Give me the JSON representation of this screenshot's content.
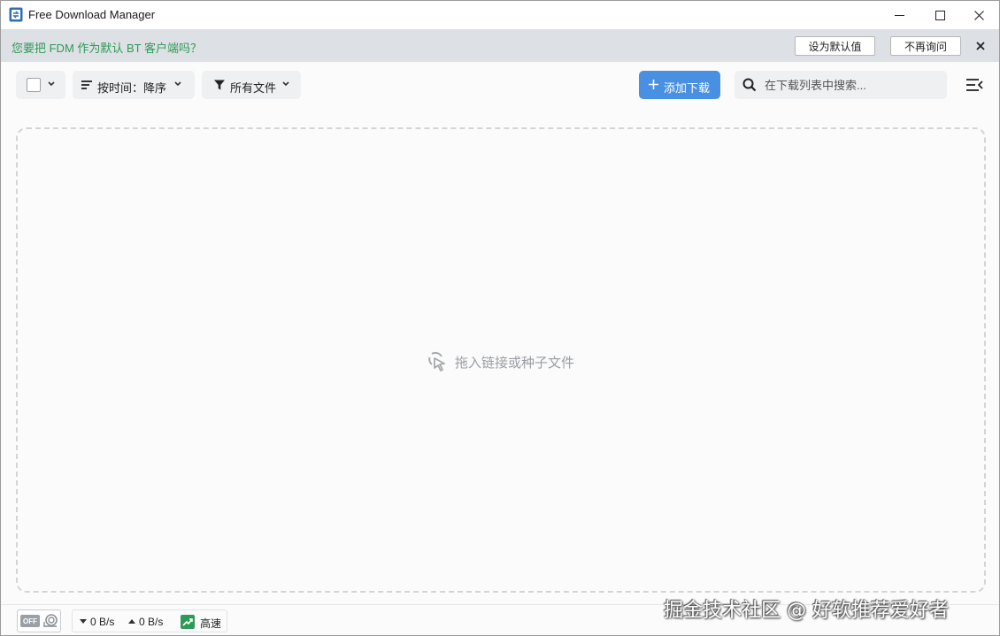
{
  "window": {
    "title": "Free Download Manager"
  },
  "bt_prompt": {
    "message": "您要把 FDM 作为默认 BT 客户端吗？",
    "set_default_label": "设为默认值",
    "never_ask_label": "不再询问"
  },
  "toolbar": {
    "sort_label": "按时间：降序",
    "filter_label": "所有文件",
    "add_download_label": "添加下载",
    "search_placeholder": "在下载列表中搜索..."
  },
  "dropzone": {
    "hint": "拖入链接或种子文件"
  },
  "statusbar": {
    "snail_mode": "OFF",
    "download_speed": "0 B/s",
    "upload_speed": "0 B/s",
    "traffic_mode": "高速"
  },
  "watermark": "掘金技术社区 @ 好软推荐爱好者",
  "colors": {
    "accent": "#4a90e2",
    "prompt_text": "#2e9a57",
    "prompt_bg": "#dde0e4",
    "speed_icon": "#2e9a57"
  },
  "icons": {
    "app": "fdm-logo-icon",
    "minimize": "minimize-icon",
    "maximize": "maximize-icon",
    "close": "close-icon",
    "sort": "sort-lines-icon",
    "filter": "funnel-icon",
    "add": "plus-icon",
    "search": "search-icon",
    "menu": "menu-collapse-icon",
    "drop": "pointer-click-icon",
    "snail": "snail-icon",
    "speed": "trend-up-icon"
  }
}
